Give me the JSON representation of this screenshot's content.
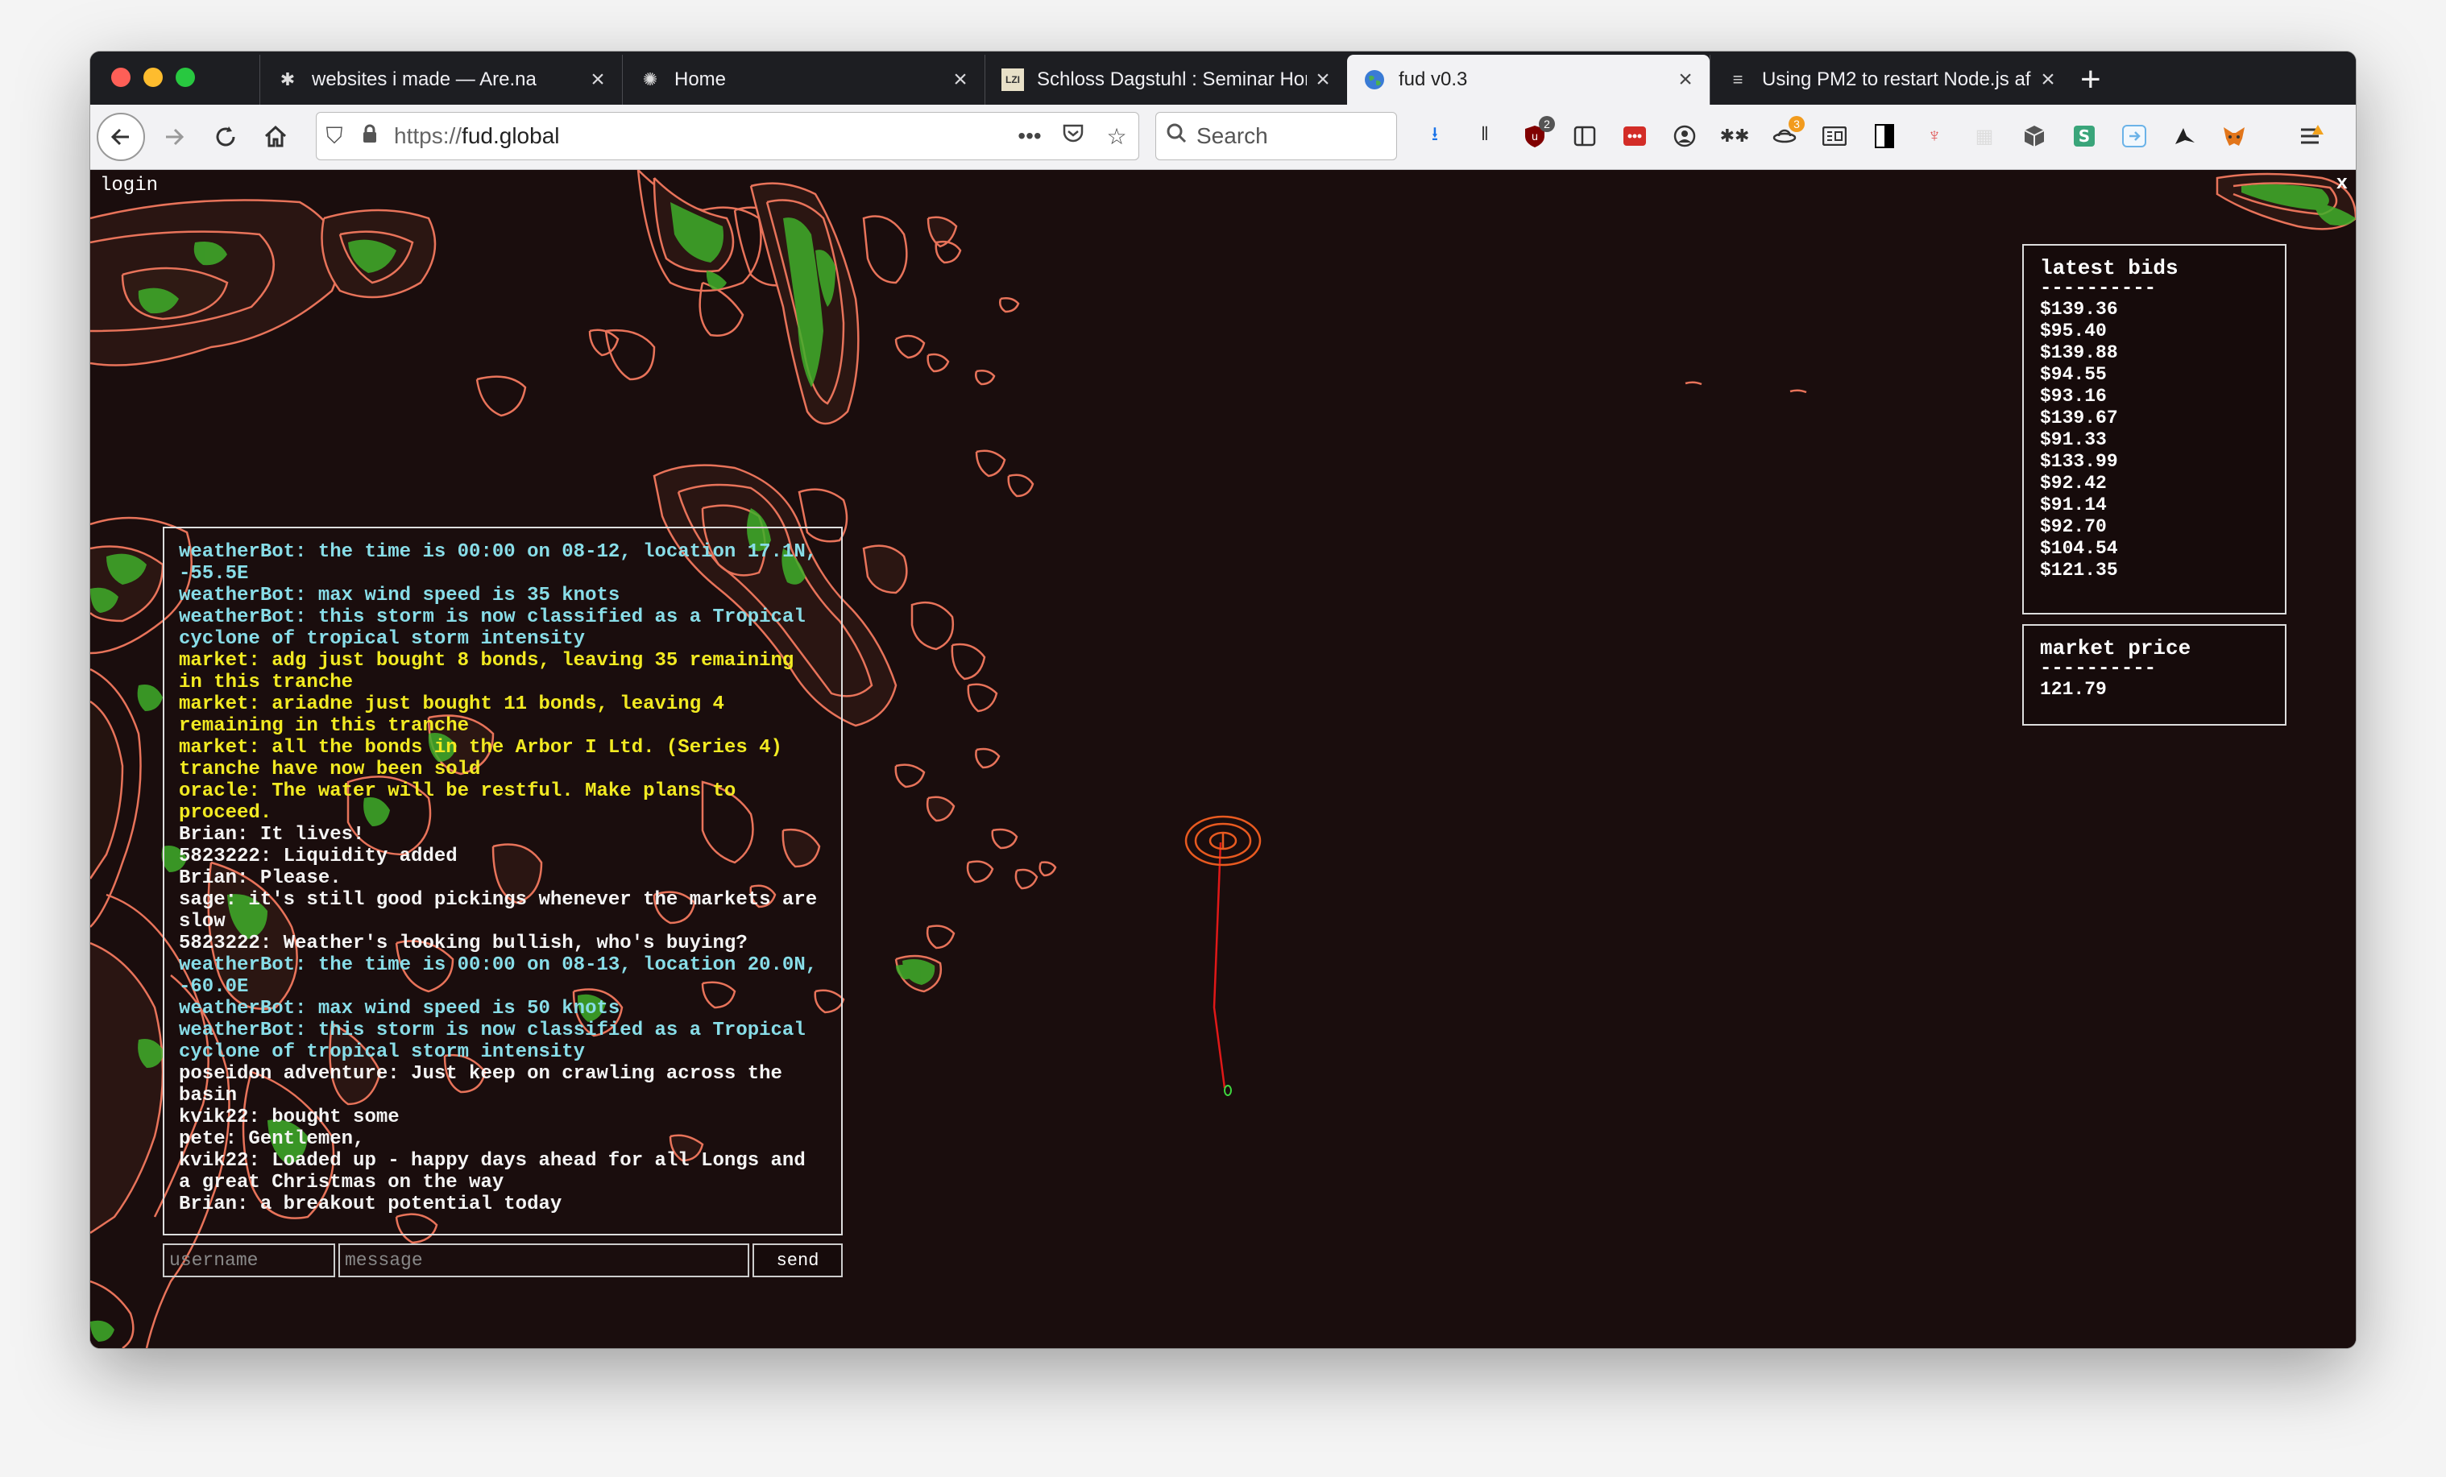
{
  "browser": {
    "tabs": [
      {
        "title": "websites i made — Are.na",
        "icon": "arena-icon"
      },
      {
        "title": "Home",
        "icon": "home-spinner-icon"
      },
      {
        "title": "Schloss Dagstuhl : Seminar Hom",
        "icon": "lzi-icon"
      },
      {
        "title": "fud v0.3",
        "icon": "globe-icon",
        "active": true
      },
      {
        "title": "Using PM2 to restart Node.js af",
        "icon": "doc-icon"
      }
    ],
    "url_protocol": "https://",
    "url_host": "fud.global",
    "search_placeholder": "Search",
    "ext_badges": {
      "ublock": "2",
      "ufo": "3"
    }
  },
  "page": {
    "login_label": "login",
    "close_label": "x"
  },
  "chat": {
    "messages": [
      {
        "text": "weatherBot: the time is 00:00 on 08-12, location 17.1N, -55.5E",
        "color": "cyan"
      },
      {
        "text": "weatherBot: max wind speed is 35 knots",
        "color": "cyan"
      },
      {
        "text": "weatherBot: this storm is now classified as a Tropical cyclone of tropical storm intensity",
        "color": "cyan"
      },
      {
        "text": "market: adg just bought 8 bonds, leaving 35 remaining in this tranche",
        "color": "yellow"
      },
      {
        "text": "market: ariadne just bought 11 bonds, leaving 4 remaining in this tranche",
        "color": "yellow"
      },
      {
        "text": "market: all the bonds in the Arbor I Ltd. (Series 4) tranche have now been sold",
        "color": "yellow"
      },
      {
        "text": "oracle: The water will be restful. Make plans to proceed.",
        "color": "yellow"
      },
      {
        "text": "Brian: It lives!",
        "color": "white"
      },
      {
        "text": "5823222: Liquidity added",
        "color": "white"
      },
      {
        "text": "Brian: Please.",
        "color": "white"
      },
      {
        "text": "sage: it's still good pickings whenever the markets are slow",
        "color": "white"
      },
      {
        "text": "5823222: Weather's looking bullish, who's buying?",
        "color": "white"
      },
      {
        "text": "weatherBot: the time is 00:00 on 08-13, location 20.0N, -60.0E",
        "color": "cyan"
      },
      {
        "text": "weatherBot: max wind speed is 50 knots",
        "color": "cyan"
      },
      {
        "text": "weatherBot: this storm is now classified as a Tropical cyclone of tropical storm intensity",
        "color": "cyan"
      },
      {
        "text": "poseidon adventure: Just keep on crawling across the basin",
        "color": "white"
      },
      {
        "text": "kvik22: bought some",
        "color": "white"
      },
      {
        "text": "pete: Gentlemen,",
        "color": "white"
      },
      {
        "text": "kvik22: Loaded up - happy days ahead for all Longs and a great Christmas on the way",
        "color": "white"
      },
      {
        "text": "Brian: a breakout potential today",
        "color": "white"
      }
    ],
    "username_placeholder": "username",
    "message_placeholder": "message",
    "send_label": "send"
  },
  "bids": {
    "title": "latest bids",
    "divider": "----------",
    "values": [
      "$139.36",
      "$95.40",
      "$139.88",
      "$94.55",
      "$93.16",
      "$139.67",
      "$91.33",
      "$133.99",
      "$92.42",
      "$91.14",
      "$92.70",
      "$104.54",
      "$121.35"
    ]
  },
  "market": {
    "title": "market price",
    "divider": "----------",
    "value": "121.79"
  },
  "colors": {
    "background": "#1a0d0d",
    "coast": "#e8735a",
    "land": "#3fae2a",
    "storm_track": "#e01818",
    "weatherBot": "#88dde8",
    "market": "#f2ea22",
    "user": "#f4f4f4"
  }
}
